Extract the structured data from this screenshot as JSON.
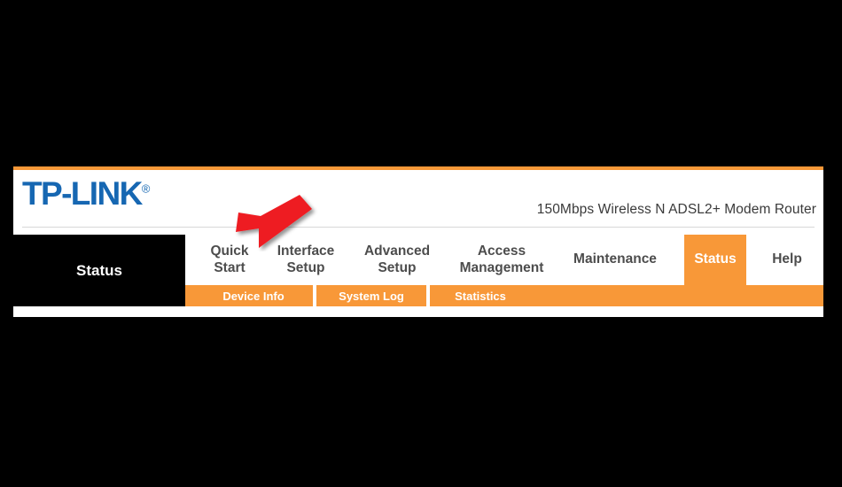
{
  "panel": {
    "brand": {
      "name": "TP-LINK",
      "registered_mark": "®",
      "color": "#1667B2"
    },
    "model_name": "150Mbps Wireless N ADSL2+ Modem Router",
    "accent_color": "#F89838",
    "section_title": "Status"
  },
  "main_nav": [
    {
      "label_line1": "Quick",
      "label_line2": "Start",
      "active": false
    },
    {
      "label_line1": "Interface",
      "label_line2": "Setup",
      "active": false
    },
    {
      "label_line1": "Advanced",
      "label_line2": "Setup",
      "active": false
    },
    {
      "label_line1": "Access",
      "label_line2": "Management",
      "active": false
    },
    {
      "label_line1": "Maintenance",
      "label_line2": "",
      "active": false
    },
    {
      "label_line1": "Status",
      "label_line2": "",
      "active": true
    },
    {
      "label_line1": "Help",
      "label_line2": "",
      "active": false
    }
  ],
  "sub_nav": [
    {
      "label": "Device Info"
    },
    {
      "label": "System Log"
    },
    {
      "label": "Statistics"
    }
  ],
  "annotation": {
    "type": "arrow",
    "color": "#EE1C21",
    "points_to": "Quick Start",
    "direction": "down-left"
  }
}
